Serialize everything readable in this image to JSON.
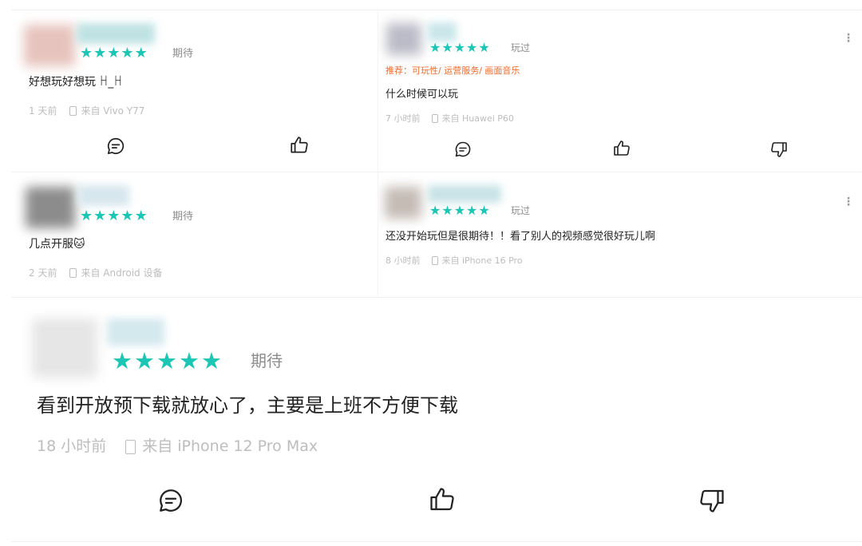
{
  "reviews": [
    {
      "status": "期待",
      "stars": 5,
      "text": "好想玩好想玩 ꀿ_ꀿ",
      "time": "1 天前",
      "device": "来自 Vivo Y77",
      "avatar_color": "#e7c3bd",
      "name_color": "#bfe2e3"
    },
    {
      "status": "玩过",
      "stars": 5,
      "recommend": "推荐：可玩性/ 运营服务/ 画面音乐",
      "text": "什么时候可以玩",
      "time": "7 小时前",
      "device": "来自 Huawei P60",
      "avatar_color": "#bcbcc8",
      "name_color": "#c9e6ea"
    },
    {
      "status": "期待",
      "stars": 5,
      "text": "几点开服🐱",
      "time": "2 天前",
      "device": "来自 Android 设备",
      "avatar_color": "#8c8c8c",
      "name_color": "#d6e7ee"
    },
    {
      "status": "玩过",
      "stars": 5,
      "text": "还没开始玩但是很期待！！看了别人的视频感觉很好玩儿啊",
      "time": "8 小时前",
      "device": "来自 iPhone 16 Pro",
      "avatar_color": "#c5bcb6",
      "name_color": "#c8e3e6"
    },
    {
      "status": "期待",
      "stars": 5,
      "text": "看到开放预下载就放心了，主要是上班不方便下载",
      "time": "18 小时前",
      "device": "来自 iPhone 12 Pro Max",
      "avatar_color": "#e6e6e6",
      "name_color": "#d4e9ee"
    }
  ],
  "colors": {
    "star": "#1cc6b5",
    "recommend": "#f06a2b",
    "meta": "#bdbdbd"
  },
  "icons": [
    "comment-icon",
    "thumbs-up-icon",
    "thumbs-down-icon",
    "more-icon",
    "phone-icon",
    "star-icon"
  ]
}
